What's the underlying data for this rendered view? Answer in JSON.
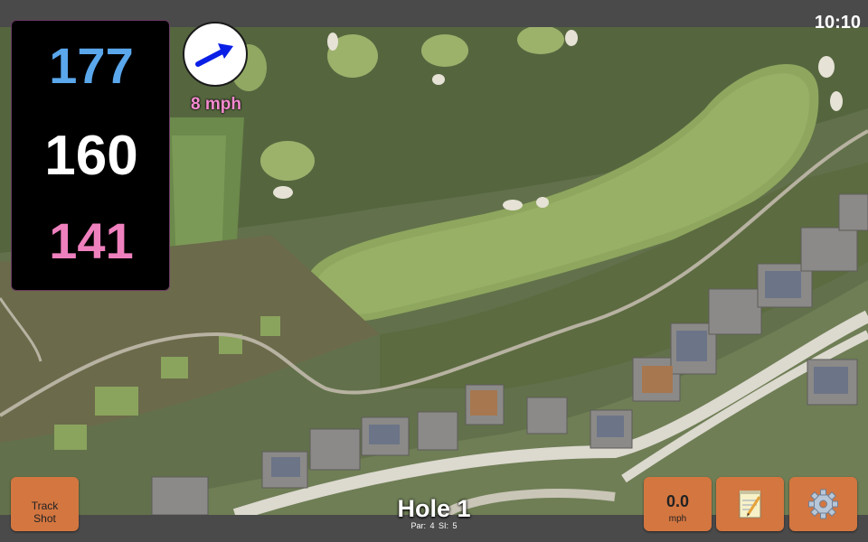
{
  "status": {
    "time": "10:10"
  },
  "distances": {
    "back": "177",
    "middle": "160",
    "front": "141"
  },
  "wind": {
    "direction_icon": "arrow-right-icon",
    "speed_label": "8 mph"
  },
  "buttons": {
    "track_shot": {
      "line1": "Track",
      "line2": "Shot"
    },
    "wind_speed": {
      "value": "0.0",
      "unit": "mph"
    },
    "notes": {
      "icon": "notepad-icon"
    },
    "settings": {
      "icon": "gear-icon"
    }
  },
  "hole": {
    "title": "Hole 1",
    "par_label": "Par: 4",
    "si_label": "SI: 5"
  },
  "colors": {
    "back_distance": "#5aa7ec",
    "middle_distance": "#ffffff",
    "front_distance": "#ef80be",
    "wind_label": "#f58ad0",
    "button": "#d47640",
    "bar": "#4a4a4a"
  }
}
